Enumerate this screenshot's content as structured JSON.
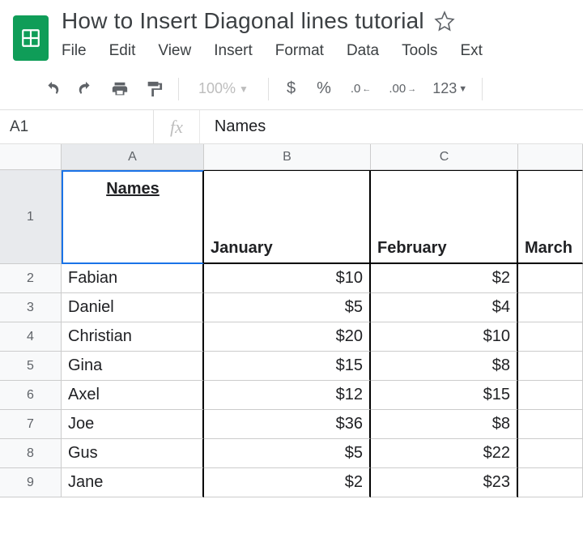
{
  "doc_title": "How to Insert Diagonal lines tutorial",
  "menus": [
    "File",
    "Edit",
    "View",
    "Insert",
    "Format",
    "Data",
    "Tools",
    "Ext"
  ],
  "toolbar": {
    "zoom": "100%",
    "currency": "$",
    "percent": "%",
    "dec_less": ".0",
    "dec_more": ".00",
    "fmt": "123"
  },
  "cell_ref": "A1",
  "fx_label": "fx",
  "formula_value": "Names",
  "col_headers": [
    "A",
    "B",
    "C",
    ""
  ],
  "header_row": {
    "a1_label": "Names",
    "b": "January",
    "c": "February",
    "d": "March"
  },
  "rows": [
    {
      "n": "2",
      "a": "Fabian",
      "b": "$10",
      "c": "$2"
    },
    {
      "n": "3",
      "a": "Daniel",
      "b": "$5",
      "c": "$4"
    },
    {
      "n": "4",
      "a": "Christian",
      "b": "$20",
      "c": "$10"
    },
    {
      "n": "5",
      "a": "Gina",
      "b": "$15",
      "c": "$8"
    },
    {
      "n": "6",
      "a": "Axel",
      "b": "$12",
      "c": "$15"
    },
    {
      "n": "7",
      "a": "Joe",
      "b": "$36",
      "c": "$8"
    },
    {
      "n": "8",
      "a": "Gus",
      "b": "$5",
      "c": "$22"
    },
    {
      "n": "9",
      "a": "Jane",
      "b": "$2",
      "c": "$23"
    }
  ]
}
